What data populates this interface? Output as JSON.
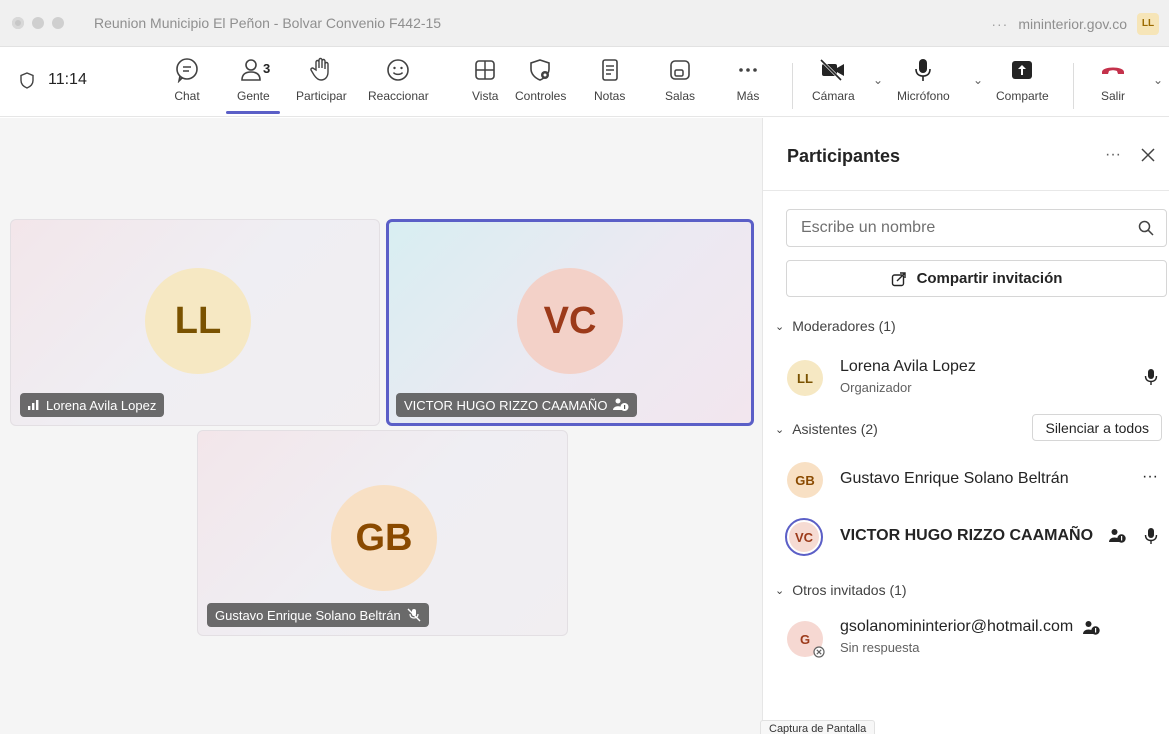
{
  "window": {
    "title": "Reunion Municipio El Peñon - Bolvar Convenio F442-15",
    "domain": "mininterior.gov.co",
    "user_initials": "LL",
    "more": "···"
  },
  "toolbar": {
    "timer": "11:14",
    "people_count": "3",
    "items": {
      "chat": "Chat",
      "people": "Gente",
      "raise": "Participar",
      "react": "Reaccionar",
      "view": "Vista",
      "controls": "Controles",
      "notes": "Notas",
      "rooms": "Salas",
      "more": "Más",
      "camera": "Cámara",
      "mic": "Micrófono",
      "share": "Comparte",
      "leave": "Salir"
    },
    "active": "people"
  },
  "stage": {
    "tiles": [
      {
        "initials": "LL",
        "name": "Lorena Avila Lopez",
        "avatar_bg": "#f6e8c3",
        "avatar_fg": "#7a5200"
      },
      {
        "initials": "VC",
        "name": "VICTOR HUGO RIZZO CAAMAÑO",
        "avatar_bg": "#f3d1c8",
        "avatar_fg": "#9c3a1a"
      },
      {
        "initials": "GB",
        "name": "Gustavo Enrique Solano Beltrán",
        "avatar_bg": "#f8e0c4",
        "avatar_fg": "#8a4a00"
      }
    ]
  },
  "panel": {
    "title": "Participantes",
    "search_placeholder": "Escribe un nombre",
    "invite_label": "Compartir invitación",
    "sections": {
      "moderators": "Moderadores (1)",
      "attendees": "Asistentes (2)",
      "others": "Otros invitados (1)"
    },
    "mute_all": "Silenciar a todos",
    "moderators": [
      {
        "initials": "LL",
        "name": "Lorena Avila Lopez",
        "role": "Organizador"
      }
    ],
    "attendees": [
      {
        "initials": "GB",
        "name": "Gustavo Enrique Solano Beltrán"
      },
      {
        "initials": "VC",
        "name": "VICTOR HUGO RIZZO CAAMAÑO"
      }
    ],
    "others": [
      {
        "initials": "G",
        "name": "gsolanomininterior@hotmail.com",
        "status": "Sin respuesta"
      }
    ]
  },
  "tooltip": "Captura de Pantalla",
  "colors": {
    "accent": "#5b5fc7",
    "leave": "#c4314b"
  }
}
